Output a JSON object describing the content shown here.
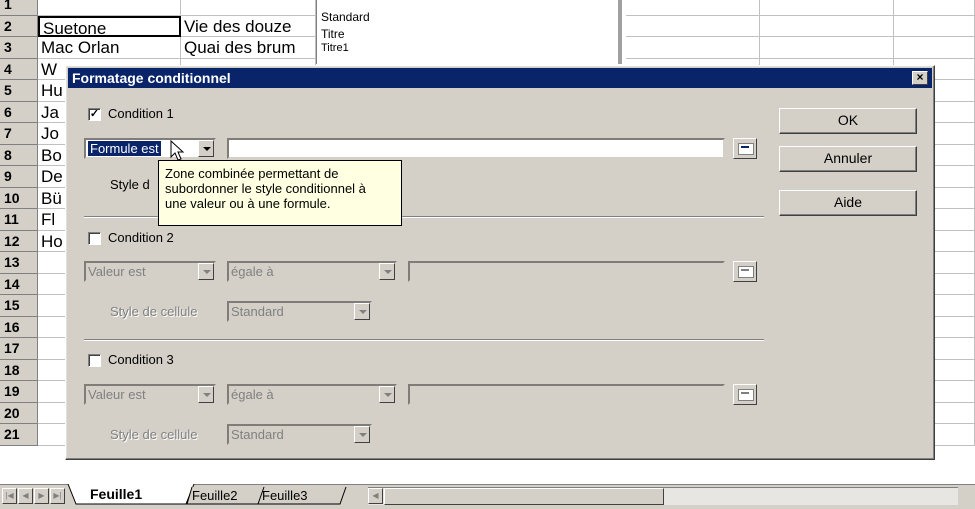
{
  "sheet": {
    "row_numbers": [
      "1",
      "2",
      "3",
      "4",
      "5",
      "6",
      "7",
      "8",
      "9",
      "10",
      "11",
      "12",
      "13",
      "14",
      "15",
      "16",
      "17",
      "18",
      "19",
      "20",
      "21"
    ],
    "col_a": [
      "",
      "Suetone",
      "Mac Orlan",
      "W",
      "Hu",
      "Ja",
      "Jo",
      "Bo",
      "De",
      "Bü",
      "Fl",
      "Ho",
      "",
      "",
      "",
      "",
      "",
      "",
      "",
      "",
      ""
    ],
    "col_b": [
      "",
      "Vie des douze",
      "Quai des brum",
      "",
      "",
      "",
      "",
      "",
      "",
      "",
      "",
      "",
      "",
      "",
      "",
      "",
      "",
      "",
      "",
      "",
      ""
    ],
    "style_list": [
      "Standard",
      "Titre",
      "Titre1"
    ]
  },
  "dialog": {
    "title": "Formatage conditionnel",
    "buttons": {
      "ok": "OK",
      "cancel": "Annuler",
      "help": "Aide"
    },
    "conditions": [
      {
        "label": "Condition 1",
        "checked": true,
        "type": "Formule est",
        "style_label": "Style d"
      },
      {
        "label": "Condition 2",
        "checked": false,
        "type": "Valeur est",
        "operator": "égale à",
        "style_label": "Style de cellule",
        "style": "Standard"
      },
      {
        "label": "Condition 3",
        "checked": false,
        "type": "Valeur est",
        "operator": "égale à",
        "style_label": "Style de cellule",
        "style": "Standard"
      }
    ],
    "tooltip": {
      "line1": "Zone combinée permettant de",
      "line2": "subordonner le style conditionnel à",
      "line3": "une valeur ou à une formule."
    }
  },
  "tabs": [
    "Feuille1",
    "Feuille2",
    "Feuille3"
  ],
  "active_tab": "Feuille1",
  "colors": {
    "titlebar": "#0a246a",
    "face": "#d4d0c8",
    "tooltip": "#ffffe1"
  }
}
